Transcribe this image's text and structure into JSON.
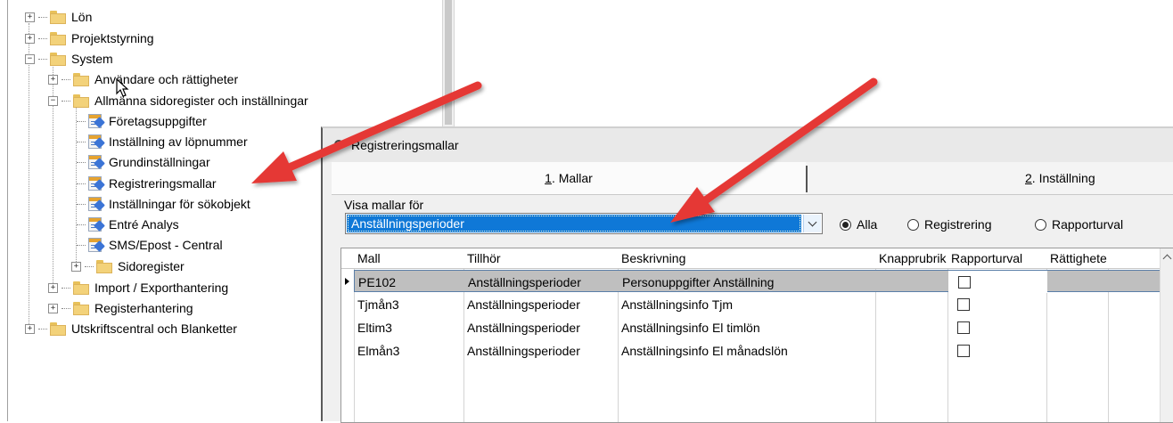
{
  "tree": {
    "items": [
      {
        "label": "Lön"
      },
      {
        "label": "Projektstyrning"
      },
      {
        "label": "System"
      },
      {
        "label": "Användare och rättigheter"
      },
      {
        "label": "Allmänna sidoregister och inställningar"
      },
      {
        "label": "Företagsuppgifter"
      },
      {
        "label": "Inställning av löpnummer"
      },
      {
        "label": "Grundinställningar"
      },
      {
        "label": "Registreringsmallar"
      },
      {
        "label": "Inställningar för sökobjekt"
      },
      {
        "label": "Entré Analys"
      },
      {
        "label": "SMS/Epost - Central"
      },
      {
        "label": "Sidoregister"
      },
      {
        "label": "Import / Exporthantering"
      },
      {
        "label": "Registerhantering"
      },
      {
        "label": "Utskriftscentral och Blanketter"
      }
    ]
  },
  "dialog": {
    "title": "Registreringsmallar",
    "tabs": [
      {
        "key": "1",
        "rest": ". Mallar"
      },
      {
        "key": "2",
        "rest": ". Inställning"
      }
    ],
    "filter_label": "Visa mallar för",
    "filter_value": "Anställningsperioder",
    "radios": [
      {
        "label": "Alla",
        "checked": true
      },
      {
        "label": "Registrering",
        "checked": false
      },
      {
        "label": "Rapporturval",
        "checked": false
      }
    ],
    "grid": {
      "columns": [
        "Mall",
        "Tillhör",
        "Beskrivning",
        "Knapprubrik",
        "Rapporturval",
        "Rättighete"
      ],
      "rows": [
        {
          "mall": "PE102",
          "tillhor": "Anställningsperioder",
          "beskrivning": "Personuppgifter Anställning",
          "selected": true
        },
        {
          "mall": "Tjmån3",
          "tillhor": "Anställningsperioder",
          "beskrivning": "Anställningsinfo Tjm",
          "selected": false
        },
        {
          "mall": "Eltim3",
          "tillhor": "Anställningsperioder",
          "beskrivning": "Anställningsinfo El timlön",
          "selected": false
        },
        {
          "mall": "Elmån3",
          "tillhor": "Anställningsperioder",
          "beskrivning": "Anställningsinfo El månadslön",
          "selected": false
        }
      ]
    }
  },
  "colors": {
    "selection": "#0f78d7",
    "annotation_arrow": "#e53935",
    "folder": "#f3d27a"
  }
}
